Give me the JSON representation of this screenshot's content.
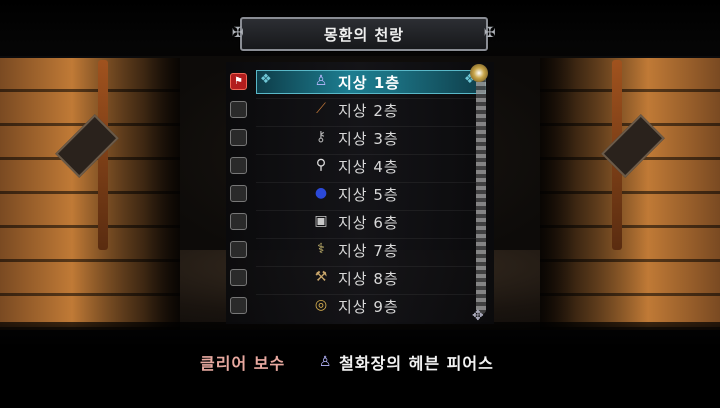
{
  "header": {
    "title": "몽환의 천랑"
  },
  "floors": [
    {
      "label": "지상 1층",
      "selected": true,
      "icon": "gauntlet-icon",
      "glyph": "♙",
      "color": "#b8b8ff"
    },
    {
      "label": "지상 2층",
      "selected": false,
      "icon": "staff-icon",
      "glyph": "⟋",
      "color": "#c0773a"
    },
    {
      "label": "지상 3층",
      "selected": false,
      "icon": "key-icon",
      "glyph": "⚷",
      "color": "#b0b0b0"
    },
    {
      "label": "지상 4층",
      "selected": false,
      "icon": "scepter-icon",
      "glyph": "⚲",
      "color": "#e0e0e0"
    },
    {
      "label": "지상 5층",
      "selected": false,
      "icon": "blue-gem-icon",
      "glyph": "●",
      "color": "#2b49d8"
    },
    {
      "label": "지상 6층",
      "selected": false,
      "icon": "armor-icon",
      "glyph": "▣",
      "color": "#c8c8c8"
    },
    {
      "label": "지상 7층",
      "selected": false,
      "icon": "wand-icon",
      "glyph": "⚕",
      "color": "#d6c477"
    },
    {
      "label": "지상 8층",
      "selected": false,
      "icon": "axe-icon",
      "glyph": "⚒",
      "color": "#c9a66b"
    },
    {
      "label": "지상 9층",
      "selected": false,
      "icon": "ring-icon",
      "glyph": "◎",
      "color": "#d8b050"
    }
  ],
  "reward": {
    "label": "클리어 보수",
    "item_name": "철화장의 헤븐 피어스",
    "icon": "gauntlet-icon",
    "glyph": "♙",
    "color": "#b8b8ff"
  },
  "colors": {
    "selected_band": "#1d7d90",
    "reward_label": "#e8a9a0"
  }
}
